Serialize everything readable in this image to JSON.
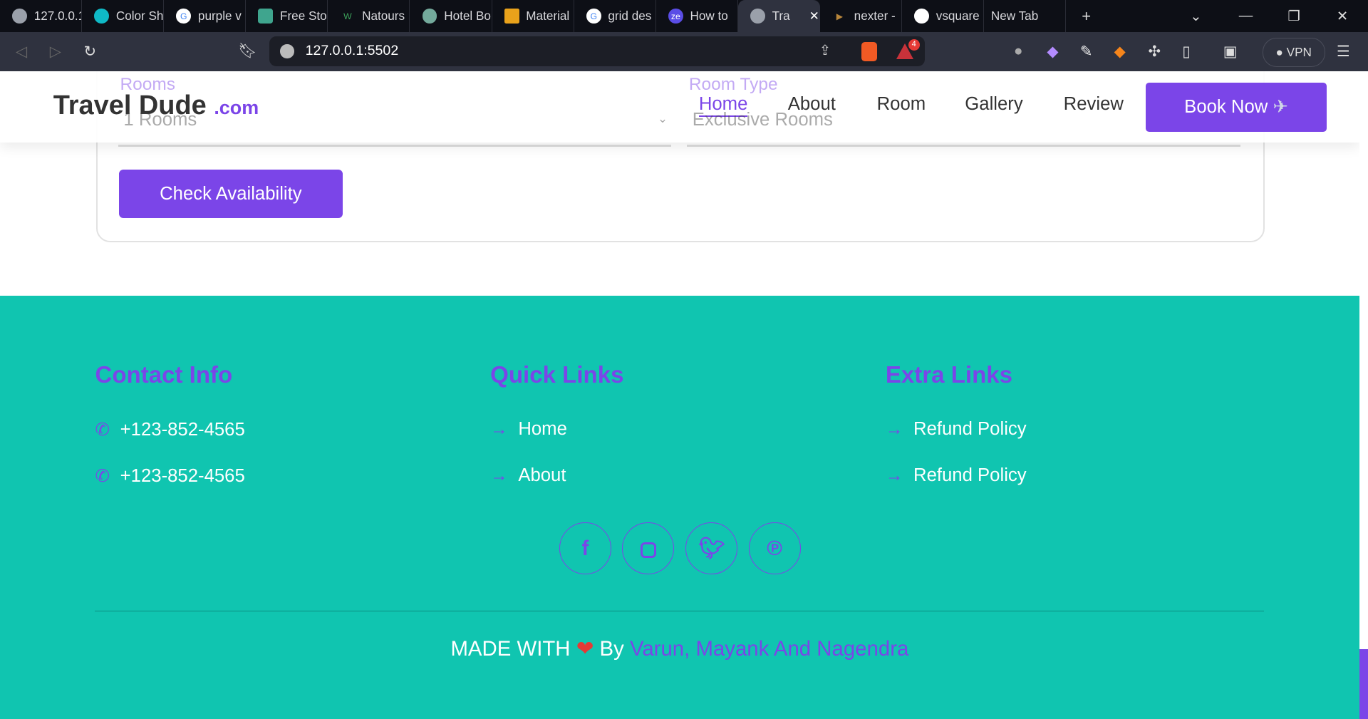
{
  "browser": {
    "tabs": [
      {
        "label": "127.0.0.1"
      },
      {
        "label": "Color Sh"
      },
      {
        "label": "purple v"
      },
      {
        "label": "Free Sto"
      },
      {
        "label": "Natours"
      },
      {
        "label": "Hotel Bo"
      },
      {
        "label": "Material"
      },
      {
        "label": "grid des"
      },
      {
        "label": "How to"
      },
      {
        "label": "Tra",
        "active": true
      },
      {
        "label": "nexter -"
      },
      {
        "label": "vsquare"
      },
      {
        "label": "New Tab"
      }
    ],
    "new_tab": "+",
    "url": "127.0.0.1:5502",
    "vpn": "VPN",
    "brave_badge": "4"
  },
  "header": {
    "logo": "Travel Dude",
    "logo_suffix": ".com",
    "nav": [
      "Home",
      "About",
      "Room",
      "Gallery",
      "Review"
    ],
    "book": "Book Now"
  },
  "form": {
    "rooms_label": "Rooms",
    "rooms_value": "1 Rooms",
    "type_label": "Room Type",
    "type_value": "Exclusive Rooms",
    "check": "Check Availability"
  },
  "footer": {
    "contact_title": "Contact Info",
    "phones": [
      "+123-852-4565",
      "+123-852-4565"
    ],
    "quick_title": "Quick Links",
    "quick": [
      "Home",
      "About"
    ],
    "extra_title": "Extra Links",
    "extra": [
      "Refund Policy",
      "Refund Policy"
    ],
    "made": "MADE WITH",
    "by": "By",
    "names": "Varun, Mayank And Nagendra"
  },
  "colors": {
    "accent": "#7b45e8",
    "footer": "#10c5b0"
  }
}
